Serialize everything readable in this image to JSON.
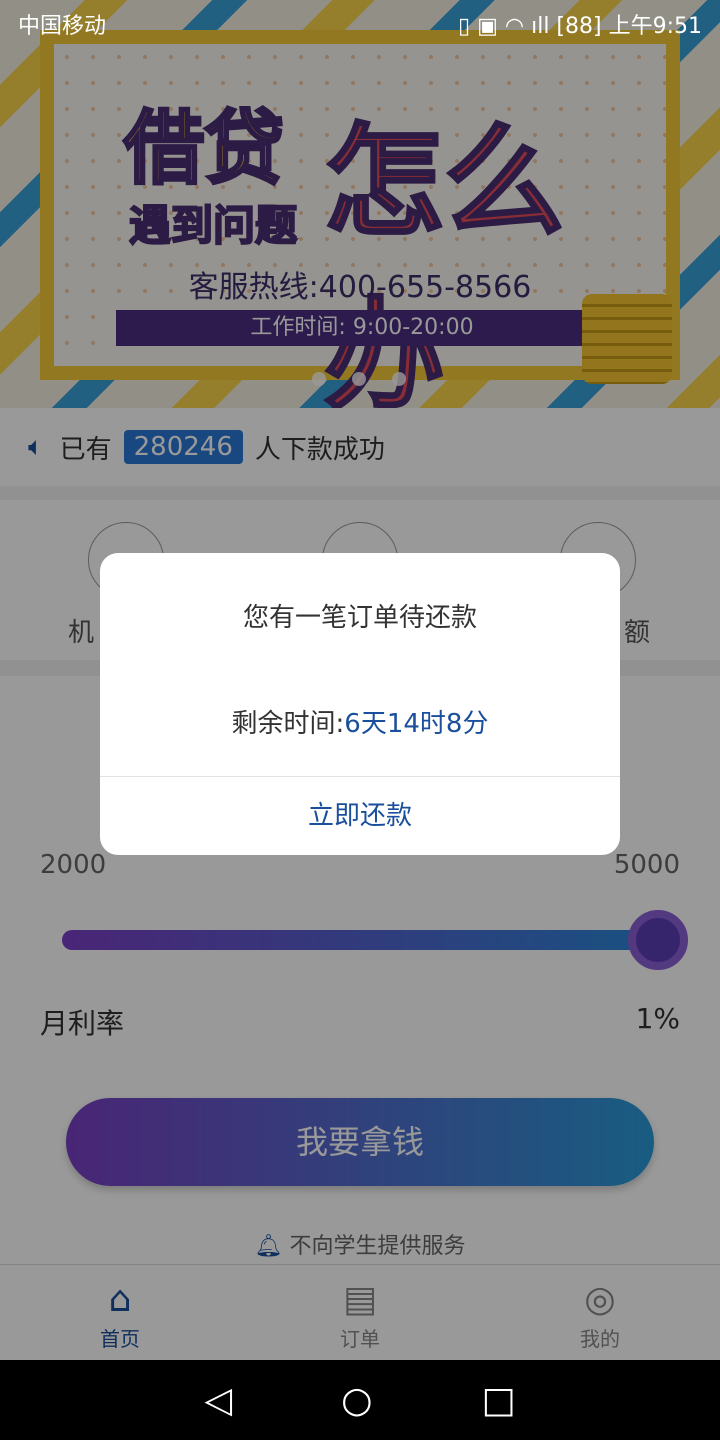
{
  "status_bar": {
    "carrier": "中国移动",
    "icons": "vibrate HD wifi 4G signal",
    "battery": "88",
    "time": "上午9:51"
  },
  "banner": {
    "title_left": "借贷",
    "subtitle": "遇到问题",
    "title_right": "怎么办",
    "hotline": "客服热线:400-655-8566",
    "hours": "工作时间: 9:00-20:00"
  },
  "notice": {
    "prefix": "已有",
    "count": "280246",
    "suffix": "人下款成功"
  },
  "features": [
    {
      "label": "机"
    },
    {
      "label": ""
    },
    {
      "label": "额"
    }
  ],
  "loan": {
    "min": "2000",
    "max": "5000",
    "slider_value": 5000,
    "rate_label": "月利率",
    "rate_value": "1%",
    "button": "我要拿钱",
    "tip": "不向学生提供服务"
  },
  "tabs": [
    {
      "label": "首页",
      "icon": "home-icon",
      "active": true
    },
    {
      "label": "订单",
      "icon": "order-icon"
    },
    {
      "label": "我的",
      "icon": "user-icon"
    }
  ],
  "modal": {
    "title": "您有一笔订单待还款",
    "remaining_label": "剩余时间:",
    "remaining_value": "6天14时8分",
    "action": "立即还款"
  },
  "colors": {
    "accent": "#1a4f9c",
    "gradient_start": "#7a3fc4",
    "gradient_end": "#2a9ad8"
  }
}
